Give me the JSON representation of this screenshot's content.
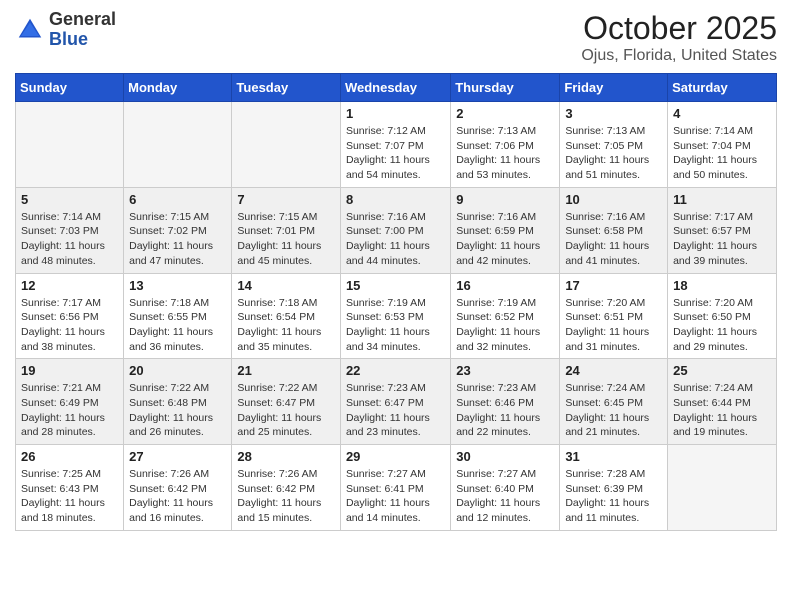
{
  "header": {
    "logo_general": "General",
    "logo_blue": "Blue",
    "month": "October 2025",
    "location": "Ojus, Florida, United States"
  },
  "weekdays": [
    "Sunday",
    "Monday",
    "Tuesday",
    "Wednesday",
    "Thursday",
    "Friday",
    "Saturday"
  ],
  "weeks": [
    [
      {
        "day": "",
        "sunrise": "",
        "sunset": "",
        "daylight": ""
      },
      {
        "day": "",
        "sunrise": "",
        "sunset": "",
        "daylight": ""
      },
      {
        "day": "",
        "sunrise": "",
        "sunset": "",
        "daylight": ""
      },
      {
        "day": "1",
        "sunrise": "Sunrise: 7:12 AM",
        "sunset": "Sunset: 7:07 PM",
        "daylight": "Daylight: 11 hours and 54 minutes."
      },
      {
        "day": "2",
        "sunrise": "Sunrise: 7:13 AM",
        "sunset": "Sunset: 7:06 PM",
        "daylight": "Daylight: 11 hours and 53 minutes."
      },
      {
        "day": "3",
        "sunrise": "Sunrise: 7:13 AM",
        "sunset": "Sunset: 7:05 PM",
        "daylight": "Daylight: 11 hours and 51 minutes."
      },
      {
        "day": "4",
        "sunrise": "Sunrise: 7:14 AM",
        "sunset": "Sunset: 7:04 PM",
        "daylight": "Daylight: 11 hours and 50 minutes."
      }
    ],
    [
      {
        "day": "5",
        "sunrise": "Sunrise: 7:14 AM",
        "sunset": "Sunset: 7:03 PM",
        "daylight": "Daylight: 11 hours and 48 minutes."
      },
      {
        "day": "6",
        "sunrise": "Sunrise: 7:15 AM",
        "sunset": "Sunset: 7:02 PM",
        "daylight": "Daylight: 11 hours and 47 minutes."
      },
      {
        "day": "7",
        "sunrise": "Sunrise: 7:15 AM",
        "sunset": "Sunset: 7:01 PM",
        "daylight": "Daylight: 11 hours and 45 minutes."
      },
      {
        "day": "8",
        "sunrise": "Sunrise: 7:16 AM",
        "sunset": "Sunset: 7:00 PM",
        "daylight": "Daylight: 11 hours and 44 minutes."
      },
      {
        "day": "9",
        "sunrise": "Sunrise: 7:16 AM",
        "sunset": "Sunset: 6:59 PM",
        "daylight": "Daylight: 11 hours and 42 minutes."
      },
      {
        "day": "10",
        "sunrise": "Sunrise: 7:16 AM",
        "sunset": "Sunset: 6:58 PM",
        "daylight": "Daylight: 11 hours and 41 minutes."
      },
      {
        "day": "11",
        "sunrise": "Sunrise: 7:17 AM",
        "sunset": "Sunset: 6:57 PM",
        "daylight": "Daylight: 11 hours and 39 minutes."
      }
    ],
    [
      {
        "day": "12",
        "sunrise": "Sunrise: 7:17 AM",
        "sunset": "Sunset: 6:56 PM",
        "daylight": "Daylight: 11 hours and 38 minutes."
      },
      {
        "day": "13",
        "sunrise": "Sunrise: 7:18 AM",
        "sunset": "Sunset: 6:55 PM",
        "daylight": "Daylight: 11 hours and 36 minutes."
      },
      {
        "day": "14",
        "sunrise": "Sunrise: 7:18 AM",
        "sunset": "Sunset: 6:54 PM",
        "daylight": "Daylight: 11 hours and 35 minutes."
      },
      {
        "day": "15",
        "sunrise": "Sunrise: 7:19 AM",
        "sunset": "Sunset: 6:53 PM",
        "daylight": "Daylight: 11 hours and 34 minutes."
      },
      {
        "day": "16",
        "sunrise": "Sunrise: 7:19 AM",
        "sunset": "Sunset: 6:52 PM",
        "daylight": "Daylight: 11 hours and 32 minutes."
      },
      {
        "day": "17",
        "sunrise": "Sunrise: 7:20 AM",
        "sunset": "Sunset: 6:51 PM",
        "daylight": "Daylight: 11 hours and 31 minutes."
      },
      {
        "day": "18",
        "sunrise": "Sunrise: 7:20 AM",
        "sunset": "Sunset: 6:50 PM",
        "daylight": "Daylight: 11 hours and 29 minutes."
      }
    ],
    [
      {
        "day": "19",
        "sunrise": "Sunrise: 7:21 AM",
        "sunset": "Sunset: 6:49 PM",
        "daylight": "Daylight: 11 hours and 28 minutes."
      },
      {
        "day": "20",
        "sunrise": "Sunrise: 7:22 AM",
        "sunset": "Sunset: 6:48 PM",
        "daylight": "Daylight: 11 hours and 26 minutes."
      },
      {
        "day": "21",
        "sunrise": "Sunrise: 7:22 AM",
        "sunset": "Sunset: 6:47 PM",
        "daylight": "Daylight: 11 hours and 25 minutes."
      },
      {
        "day": "22",
        "sunrise": "Sunrise: 7:23 AM",
        "sunset": "Sunset: 6:47 PM",
        "daylight": "Daylight: 11 hours and 23 minutes."
      },
      {
        "day": "23",
        "sunrise": "Sunrise: 7:23 AM",
        "sunset": "Sunset: 6:46 PM",
        "daylight": "Daylight: 11 hours and 22 minutes."
      },
      {
        "day": "24",
        "sunrise": "Sunrise: 7:24 AM",
        "sunset": "Sunset: 6:45 PM",
        "daylight": "Daylight: 11 hours and 21 minutes."
      },
      {
        "day": "25",
        "sunrise": "Sunrise: 7:24 AM",
        "sunset": "Sunset: 6:44 PM",
        "daylight": "Daylight: 11 hours and 19 minutes."
      }
    ],
    [
      {
        "day": "26",
        "sunrise": "Sunrise: 7:25 AM",
        "sunset": "Sunset: 6:43 PM",
        "daylight": "Daylight: 11 hours and 18 minutes."
      },
      {
        "day": "27",
        "sunrise": "Sunrise: 7:26 AM",
        "sunset": "Sunset: 6:42 PM",
        "daylight": "Daylight: 11 hours and 16 minutes."
      },
      {
        "day": "28",
        "sunrise": "Sunrise: 7:26 AM",
        "sunset": "Sunset: 6:42 PM",
        "daylight": "Daylight: 11 hours and 15 minutes."
      },
      {
        "day": "29",
        "sunrise": "Sunrise: 7:27 AM",
        "sunset": "Sunset: 6:41 PM",
        "daylight": "Daylight: 11 hours and 14 minutes."
      },
      {
        "day": "30",
        "sunrise": "Sunrise: 7:27 AM",
        "sunset": "Sunset: 6:40 PM",
        "daylight": "Daylight: 11 hours and 12 minutes."
      },
      {
        "day": "31",
        "sunrise": "Sunrise: 7:28 AM",
        "sunset": "Sunset: 6:39 PM",
        "daylight": "Daylight: 11 hours and 11 minutes."
      },
      {
        "day": "",
        "sunrise": "",
        "sunset": "",
        "daylight": ""
      }
    ]
  ]
}
